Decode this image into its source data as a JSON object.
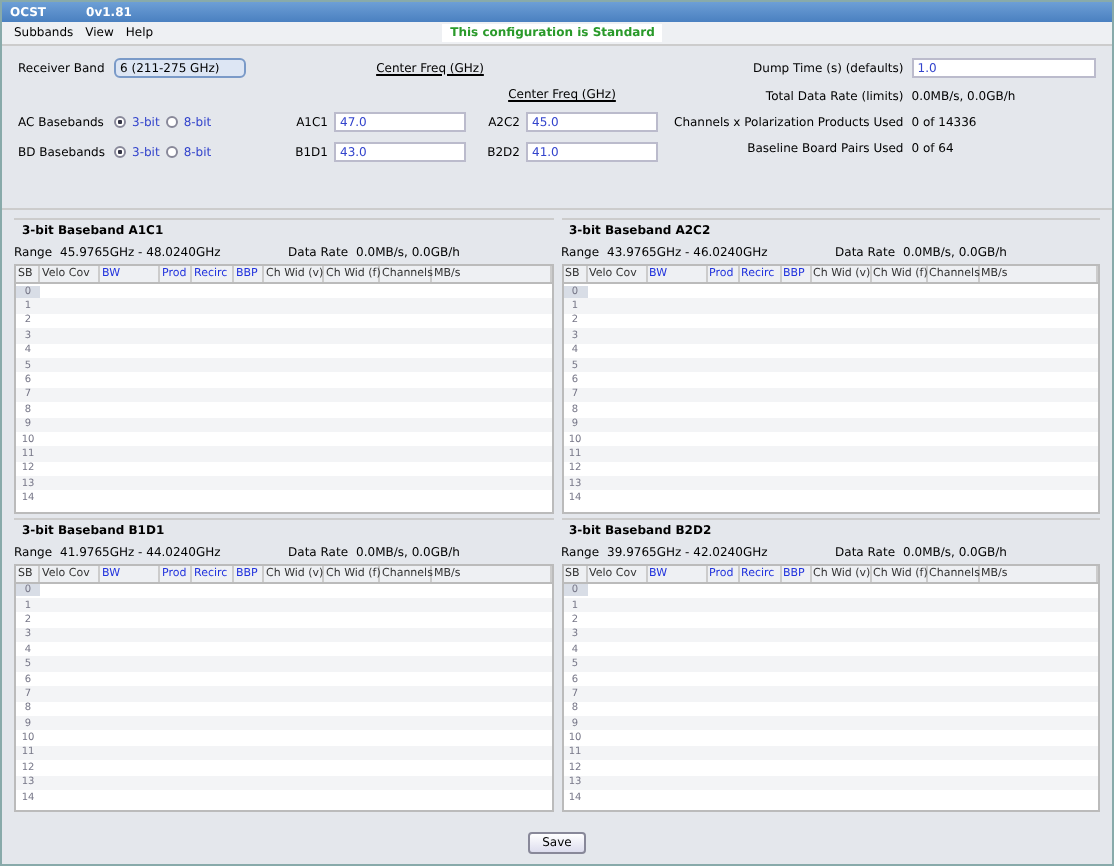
{
  "window": {
    "title": "OCST",
    "version": "0v1.81"
  },
  "menu": [
    "Subbands",
    "View",
    "Help"
  ],
  "status": "This configuration is Standard",
  "receiver_band": {
    "label": "Receiver Band",
    "value": "6 (211-275 GHz)"
  },
  "basebands": [
    {
      "label": "AC Basebands",
      "options": [
        {
          "label": "3-bit",
          "selected": true
        },
        {
          "label": "8-bit",
          "selected": false
        }
      ]
    },
    {
      "label": "BD Basebands",
      "options": [
        {
          "label": "3-bit",
          "selected": true
        },
        {
          "label": "8-bit",
          "selected": false
        }
      ]
    }
  ],
  "center_freq_headers": [
    "Center Freq (GHz)",
    "Center Freq (GHz)"
  ],
  "center_freqs": [
    {
      "label": "A1C1",
      "value": "47.0"
    },
    {
      "label": "A2C2",
      "value": "45.0"
    },
    {
      "label": "B1D1",
      "value": "43.0"
    },
    {
      "label": "B2D2",
      "value": "41.0"
    }
  ],
  "summary": [
    {
      "label": "Dump Time (s) (defaults)",
      "value": "1.0",
      "kind": "field"
    },
    {
      "label": "Total Data Rate (limits)",
      "value": "0.0MB/s, 0.0GB/h",
      "kind": "text"
    },
    {
      "label": "Channels x Polarization Products Used",
      "value": "0 of 14336",
      "kind": "text"
    },
    {
      "label": "Baseline Board Pairs Used",
      "value": "0 of 64",
      "kind": "text"
    }
  ],
  "panels": [
    {
      "title": "3-bit Baseband A1C1",
      "range_label": "Range",
      "range": "45.9765GHz - 48.0240GHz",
      "rate_label": "Data Rate",
      "rate": "0.0MB/s, 0.0GB/h",
      "columns": [
        {
          "label": "SB",
          "kind": "plain"
        },
        {
          "label": "Velo Cov",
          "kind": "plain"
        },
        {
          "label": "BW",
          "kind": "editable"
        },
        {
          "label": "Prod",
          "kind": "editable"
        },
        {
          "label": "Recirc",
          "kind": "editable"
        },
        {
          "label": "BBP",
          "kind": "editable"
        },
        {
          "label": "Ch Wid (v)",
          "kind": "plain"
        },
        {
          "label": "Ch Wid (f)",
          "kind": "plain"
        },
        {
          "label": "Channels",
          "kind": "plain"
        },
        {
          "label": "MB/s",
          "kind": "plain"
        }
      ],
      "rows": [
        {
          "sb": "0",
          "selected": true
        },
        {
          "sb": "1",
          "selected": false
        },
        {
          "sb": "2",
          "selected": false
        },
        {
          "sb": "3",
          "selected": false
        },
        {
          "sb": "4",
          "selected": false
        },
        {
          "sb": "5",
          "selected": false
        },
        {
          "sb": "6",
          "selected": false
        },
        {
          "sb": "7",
          "selected": false
        },
        {
          "sb": "8",
          "selected": false
        },
        {
          "sb": "9",
          "selected": false
        },
        {
          "sb": "10",
          "selected": false
        },
        {
          "sb": "11",
          "selected": false
        },
        {
          "sb": "12",
          "selected": false
        },
        {
          "sb": "13",
          "selected": false
        },
        {
          "sb": "14",
          "selected": false
        }
      ]
    },
    {
      "title": "3-bit Baseband A2C2",
      "range_label": "Range",
      "range": "43.9765GHz - 46.0240GHz",
      "rate_label": "Data Rate",
      "rate": "0.0MB/s, 0.0GB/h",
      "columns": [
        {
          "label": "SB",
          "kind": "plain"
        },
        {
          "label": "Velo Cov",
          "kind": "plain"
        },
        {
          "label": "BW",
          "kind": "editable"
        },
        {
          "label": "Prod",
          "kind": "editable"
        },
        {
          "label": "Recirc",
          "kind": "editable"
        },
        {
          "label": "BBP",
          "kind": "editable"
        },
        {
          "label": "Ch Wid (v)",
          "kind": "plain"
        },
        {
          "label": "Ch Wid (f)",
          "kind": "plain"
        },
        {
          "label": "Channels",
          "kind": "plain"
        },
        {
          "label": "MB/s",
          "kind": "plain"
        }
      ],
      "rows": [
        {
          "sb": "0",
          "selected": true
        },
        {
          "sb": "1",
          "selected": false
        },
        {
          "sb": "2",
          "selected": false
        },
        {
          "sb": "3",
          "selected": false
        },
        {
          "sb": "4",
          "selected": false
        },
        {
          "sb": "5",
          "selected": false
        },
        {
          "sb": "6",
          "selected": false
        },
        {
          "sb": "7",
          "selected": false
        },
        {
          "sb": "8",
          "selected": false
        },
        {
          "sb": "9",
          "selected": false
        },
        {
          "sb": "10",
          "selected": false
        },
        {
          "sb": "11",
          "selected": false
        },
        {
          "sb": "12",
          "selected": false
        },
        {
          "sb": "13",
          "selected": false
        },
        {
          "sb": "14",
          "selected": false
        }
      ]
    },
    {
      "title": "3-bit Baseband B1D1",
      "range_label": "Range",
      "range": "41.9765GHz - 44.0240GHz",
      "rate_label": "Data Rate",
      "rate": "0.0MB/s, 0.0GB/h",
      "columns": [
        {
          "label": "SB",
          "kind": "plain"
        },
        {
          "label": "Velo Cov",
          "kind": "plain"
        },
        {
          "label": "BW",
          "kind": "editable"
        },
        {
          "label": "Prod",
          "kind": "editable"
        },
        {
          "label": "Recirc",
          "kind": "editable"
        },
        {
          "label": "BBP",
          "kind": "editable"
        },
        {
          "label": "Ch Wid (v)",
          "kind": "plain"
        },
        {
          "label": "Ch Wid (f)",
          "kind": "plain"
        },
        {
          "label": "Channels",
          "kind": "plain"
        },
        {
          "label": "MB/s",
          "kind": "plain"
        }
      ],
      "rows": [
        {
          "sb": "0",
          "selected": true
        },
        {
          "sb": "1",
          "selected": false
        },
        {
          "sb": "2",
          "selected": false
        },
        {
          "sb": "3",
          "selected": false
        },
        {
          "sb": "4",
          "selected": false
        },
        {
          "sb": "5",
          "selected": false
        },
        {
          "sb": "6",
          "selected": false
        },
        {
          "sb": "7",
          "selected": false
        },
        {
          "sb": "8",
          "selected": false
        },
        {
          "sb": "9",
          "selected": false
        },
        {
          "sb": "10",
          "selected": false
        },
        {
          "sb": "11",
          "selected": false
        },
        {
          "sb": "12",
          "selected": false
        },
        {
          "sb": "13",
          "selected": false
        },
        {
          "sb": "14",
          "selected": false
        }
      ]
    },
    {
      "title": "3-bit Baseband B2D2",
      "range_label": "Range",
      "range": "39.9765GHz - 42.0240GHz",
      "rate_label": "Data Rate",
      "rate": "0.0MB/s, 0.0GB/h",
      "columns": [
        {
          "label": "SB",
          "kind": "plain"
        },
        {
          "label": "Velo Cov",
          "kind": "plain"
        },
        {
          "label": "BW",
          "kind": "editable"
        },
        {
          "label": "Prod",
          "kind": "editable"
        },
        {
          "label": "Recirc",
          "kind": "editable"
        },
        {
          "label": "BBP",
          "kind": "editable"
        },
        {
          "label": "Ch Wid (v)",
          "kind": "plain"
        },
        {
          "label": "Ch Wid (f)",
          "kind": "plain"
        },
        {
          "label": "Channels",
          "kind": "plain"
        },
        {
          "label": "MB/s",
          "kind": "plain"
        }
      ],
      "rows": [
        {
          "sb": "0",
          "selected": true
        },
        {
          "sb": "1",
          "selected": false
        },
        {
          "sb": "2",
          "selected": false
        },
        {
          "sb": "3",
          "selected": false
        },
        {
          "sb": "4",
          "selected": false
        },
        {
          "sb": "5",
          "selected": false
        },
        {
          "sb": "6",
          "selected": false
        },
        {
          "sb": "7",
          "selected": false
        },
        {
          "sb": "8",
          "selected": false
        },
        {
          "sb": "9",
          "selected": false
        },
        {
          "sb": "10",
          "selected": false
        },
        {
          "sb": "11",
          "selected": false
        },
        {
          "sb": "12",
          "selected": false
        },
        {
          "sb": "13",
          "selected": false
        },
        {
          "sb": "14",
          "selected": false
        }
      ]
    }
  ],
  "save": "Save"
}
